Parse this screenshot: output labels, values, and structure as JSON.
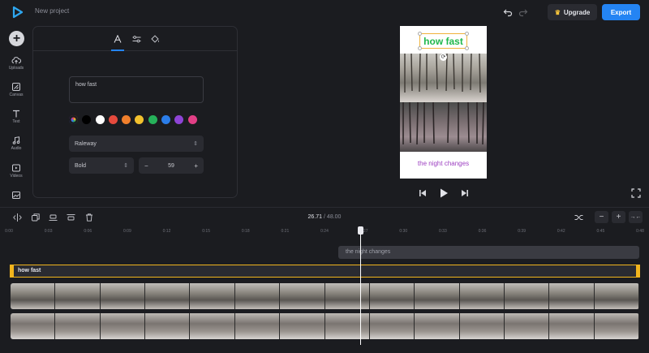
{
  "topbar": {
    "project_title": "New project",
    "upgrade_label": "Upgrade",
    "export_label": "Export",
    "accent": "#2484f3"
  },
  "sidebar": {
    "items": [
      {
        "label": "Uploads",
        "icon": "cloud-upload-icon"
      },
      {
        "label": "Canvas",
        "icon": "canvas-icon"
      },
      {
        "label": "Text",
        "icon": "text-icon"
      },
      {
        "label": "Audio",
        "icon": "music-note-icon"
      },
      {
        "label": "Videos",
        "icon": "video-icon"
      },
      {
        "label": "",
        "icon": "image-icon"
      }
    ]
  },
  "text_panel": {
    "tabs": [
      {
        "icon": "text-a-icon",
        "active": true
      },
      {
        "icon": "sliders-icon"
      },
      {
        "icon": "paint-bucket-icon"
      }
    ],
    "text_value": "how fast",
    "colors": [
      "#000000",
      "#ffffff",
      "#e64a3d",
      "#f07f2c",
      "#f2c12e",
      "#26b15a",
      "#2b7de9",
      "#8e44d6",
      "#e23f86"
    ],
    "font": "Raleway",
    "weight": "Bold",
    "size": "59"
  },
  "preview": {
    "title_text": "how fast",
    "caption_text": "the night changes"
  },
  "timeline": {
    "current_time": "26.71",
    "separator": "/",
    "total_time": "48.00",
    "ruler": [
      "0:00",
      "0:03",
      "0:06",
      "0:09",
      "0:12",
      "0:15",
      "0:18",
      "0:21",
      "0:24",
      "0:27",
      "0:30",
      "0:33",
      "0:36",
      "0:39",
      "0:42",
      "0:45",
      "0:48"
    ],
    "tracks": {
      "caption_label": "the night changes",
      "text_label": "how fast"
    }
  }
}
